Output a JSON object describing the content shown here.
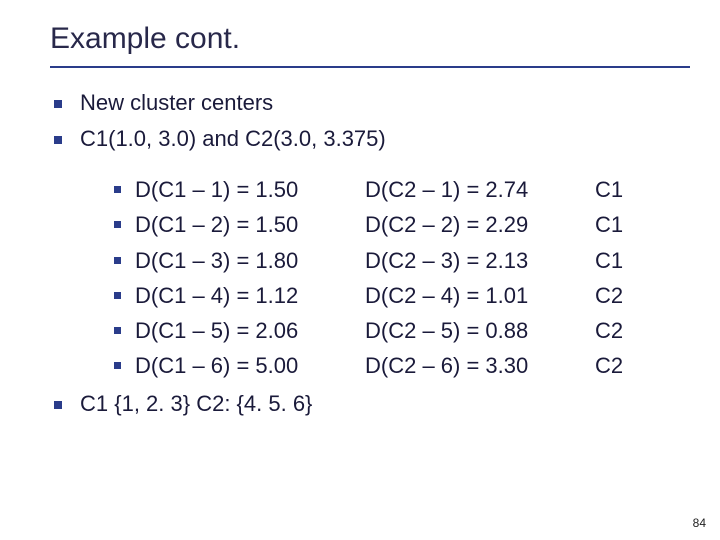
{
  "title": "Example cont.",
  "bullets_top": [
    "New cluster centers",
    "C1(1.0, 3.0) and C2(3.0, 3.375)"
  ],
  "rows": [
    {
      "c1": "D(C1 – 1) = 1.50",
      "c2": "D(C2 – 1) = 2.74",
      "c3": "C1"
    },
    {
      "c1": "D(C1 – 2) = 1.50",
      "c2": "D(C2 – 2) = 2.29",
      "c3": "C1"
    },
    {
      "c1": "D(C1 – 3) = 1.80",
      "c2": "D(C2 – 3) = 2.13",
      "c3": "C1"
    },
    {
      "c1": "D(C1 – 4) = 1.12",
      "c2": "D(C2 – 4) = 1.01",
      "c3": "C2"
    },
    {
      "c1": "D(C1 – 5) = 2.06",
      "c2": "D(C2 – 5) = 0.88",
      "c3": "C2"
    },
    {
      "c1": "D(C1 – 6) = 5.00",
      "c2": "D(C2 – 6) = 3.30",
      "c3": "C2"
    }
  ],
  "summary": "C1 {1, 2. 3} C2: {4. 5. 6}",
  "page": "84"
}
